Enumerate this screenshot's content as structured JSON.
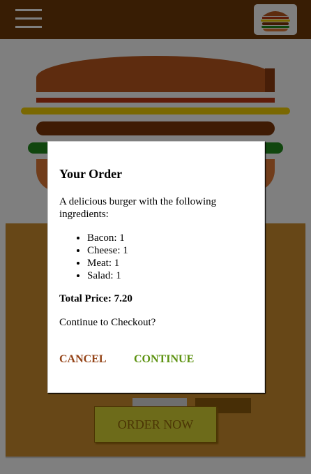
{
  "header": {
    "menu_icon": "hamburger-menu-icon",
    "logo_icon": "burger-logo-icon"
  },
  "burger": {
    "ingredients_visual": [
      "bacon",
      "cheese",
      "meat",
      "salad"
    ],
    "colors": {
      "bread": "#bc581e",
      "bacon": "#bf3813",
      "cheese": "#f4d004",
      "meat": "#7f3608",
      "salad": "#228c1d"
    }
  },
  "build_controls": {
    "order_button_label": "ORDER NOW"
  },
  "modal": {
    "title": "Your Order",
    "description": "A delicious burger with the following ingredients:",
    "ingredients": [
      {
        "name": "Bacon",
        "qty": "1",
        "label": "Bacon: 1"
      },
      {
        "name": "Cheese",
        "qty": "1",
        "label": "Cheese: 1"
      },
      {
        "name": "Meat",
        "qty": "1",
        "label": "Meat: 1"
      },
      {
        "name": "Salad",
        "qty": "1",
        "label": "Salad: 1"
      }
    ],
    "total_price_label": "Total Price: 7.20",
    "question": "Continue to Checkout?",
    "cancel_label": "CANCEL",
    "continue_label": "CONTINUE"
  },
  "colors": {
    "toolbar": "#703b09",
    "controls_bg": "#cf8f2e",
    "cancel": "#944317",
    "continue": "#5c9210"
  }
}
